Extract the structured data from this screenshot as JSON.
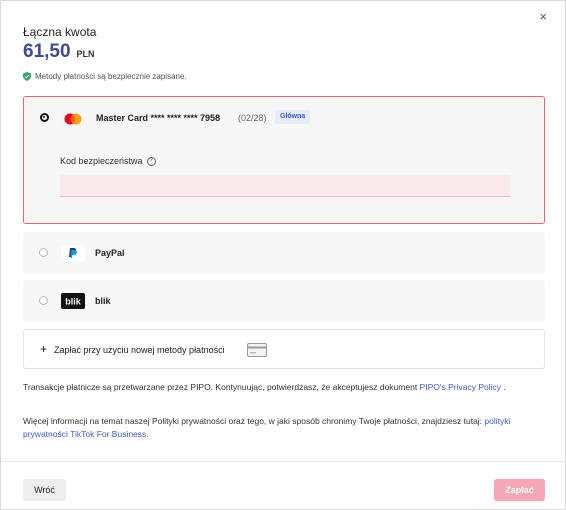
{
  "header": {
    "title": "Łączna kwota",
    "amount": "61,50",
    "currency": "PLN",
    "close_glyph": "×"
  },
  "secure_note": "Metody płatności są bezpiecznie zapisane.",
  "card": {
    "label": "Master Card **** **** **** 7958",
    "expiry": "(02/28)",
    "badge": "Główna",
    "security_label": "Kod bezpieczeństwa",
    "security_value": "",
    "icon": "mastercard-icon"
  },
  "options": [
    {
      "label": "PayPal",
      "icon": "paypal-icon"
    },
    {
      "label": "blik",
      "icon": "blik-icon"
    }
  ],
  "new_method": {
    "label": "Zapłać przy użyciu nowej metody płatności",
    "icon": "credit-card-icon"
  },
  "legal": {
    "line1": "Transakcje płatnicze są przetwarzane przez PIPO. Kontynuując, potwierdzasz, że akceptujesz dokument",
    "link1": "PIPO's Privacy Policy",
    "line1_end": ".",
    "line2": "Więcej informacji na temat naszej Polityki prywatności oraz tego, w jaki sposób chronimy Twoje płatności, znajdziesz tutaj:",
    "link2": "polityki prywatności TikTok For Business",
    "line2_end": "."
  },
  "footer": {
    "back_label": "Wróć",
    "pay_label": "Zapłać"
  },
  "colors": {
    "accent": "#3b4b99",
    "error": "#f25c6e",
    "pay_disabled": "#f5a7b3"
  }
}
